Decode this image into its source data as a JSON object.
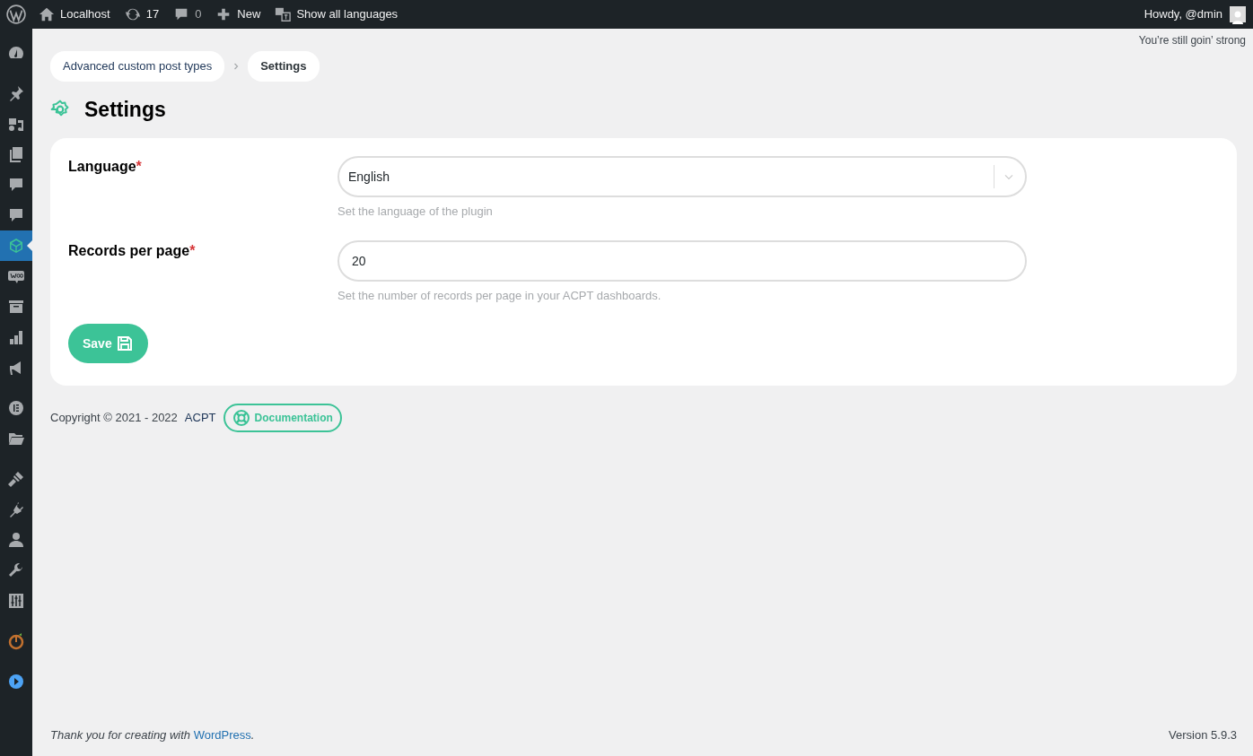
{
  "admin_bar": {
    "items": [
      {
        "kind": "home",
        "label": "Localhost"
      },
      {
        "kind": "updates",
        "label": "17"
      },
      {
        "kind": "comments",
        "label": "0"
      },
      {
        "kind": "new",
        "label": "New"
      },
      {
        "kind": "translate",
        "label": "Show all languages"
      }
    ],
    "greeting": "Howdy, @dmin"
  },
  "sidebar": {
    "groups": [
      [
        {
          "kind": "dashboard",
          "selected": false
        }
      ],
      [
        {
          "kind": "pin",
          "selected": false
        },
        {
          "kind": "media",
          "selected": false
        },
        {
          "kind": "pages",
          "selected": false
        },
        {
          "kind": "comment",
          "selected": false
        },
        {
          "kind": "comment",
          "selected": false
        },
        {
          "kind": "cube",
          "selected": true
        },
        {
          "kind": "woo",
          "selected": false
        },
        {
          "kind": "archive",
          "selected": false
        },
        {
          "kind": "bars",
          "selected": false
        },
        {
          "kind": "megaphone",
          "selected": false
        }
      ],
      [
        {
          "kind": "elementor",
          "selected": false
        },
        {
          "kind": "folder",
          "selected": false
        }
      ],
      [
        {
          "kind": "brush",
          "selected": false
        },
        {
          "kind": "plug",
          "selected": false
        },
        {
          "kind": "user",
          "selected": false
        },
        {
          "kind": "wrench",
          "selected": false
        },
        {
          "kind": "sliders",
          "selected": false
        }
      ],
      [
        {
          "kind": "power",
          "selected": false
        }
      ],
      [
        {
          "kind": "play",
          "selected": false
        }
      ]
    ]
  },
  "notice": "You’re still goin’ strong",
  "breadcrumb": [
    {
      "label": "Advanced custom post types",
      "selected": false
    },
    {
      "label": "Settings",
      "selected": true
    }
  ],
  "page_title": "Settings",
  "form": {
    "fields": [
      {
        "kind": "select",
        "label": "Language",
        "required_mark": "*",
        "value": "English",
        "help": "Set the language of the plugin"
      },
      {
        "kind": "input",
        "label": "Records per page",
        "required_mark": "*",
        "value": "20",
        "help": "Set the number of records per page in your ACPT dashboards."
      }
    ],
    "save_button": "Save"
  },
  "plugin_footer": {
    "copyright": "Copyright © 2021 - 2022",
    "brand": "ACPT",
    "docs_button": "Documentation"
  },
  "wp_footer": {
    "thanks": "Thank you for creating with ",
    "link": "WordPress",
    "thanks_end": ".",
    "version": "Version 5.9.3"
  }
}
